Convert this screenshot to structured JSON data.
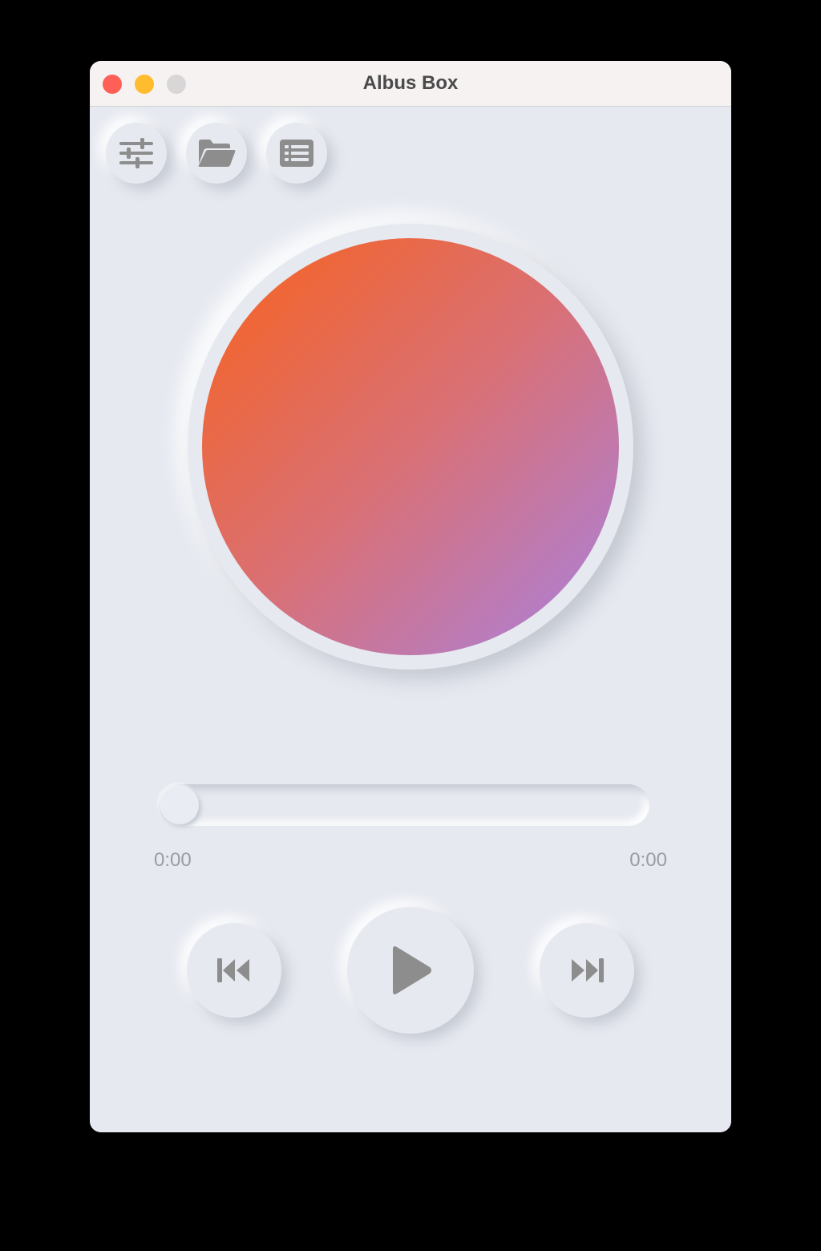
{
  "window": {
    "title": "Albus Box"
  },
  "toolbar": {
    "icons": [
      "sliders-icon",
      "folder-open-icon",
      "playlist-icon"
    ]
  },
  "album_art": {
    "gradient_start": "#f4642a",
    "gradient_mid": "#d97075",
    "gradient_end": "#b07fd0"
  },
  "player": {
    "current_time": "0:00",
    "total_time": "0:00",
    "progress": 0
  },
  "controls": {
    "icons": [
      "previous-icon",
      "play-icon",
      "next-icon"
    ]
  },
  "colors": {
    "background": "#e6e9f0",
    "icon": "#8d8d8d",
    "close": "#fe5f57",
    "minimize": "#febc2e",
    "zoom": "#d9d6d7"
  }
}
